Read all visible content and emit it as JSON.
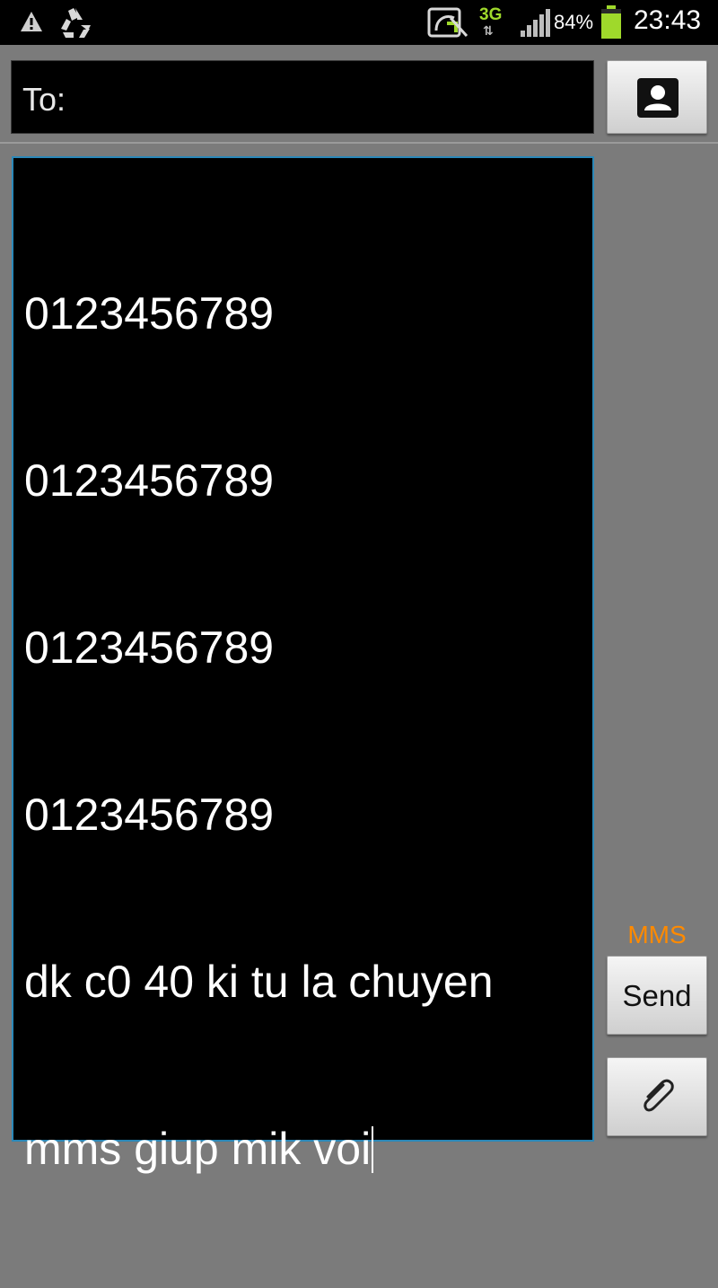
{
  "status_bar": {
    "icons": [
      "warning-icon",
      "recycle-icon",
      "sync-icon",
      "signal-icon",
      "battery-icon"
    ],
    "network": "3G",
    "network_arrows": "⇅",
    "battery_percent": "84%",
    "battery_level": 0.84,
    "battery_color": "#9fd92b",
    "time": "23:43"
  },
  "compose": {
    "recipient_label": "To:",
    "message_lines": [
      "0123456789",
      "0123456789",
      "0123456789",
      "0123456789",
      "dk c0 40 ki tu la chuyen",
      "mms giup mik voi"
    ],
    "message_type": "MMS",
    "send_label": "Send"
  },
  "colors": {
    "background": "#7b7b7b",
    "field_focus_border": "#2b88b8",
    "mms_indicator": "#ff8a00"
  }
}
